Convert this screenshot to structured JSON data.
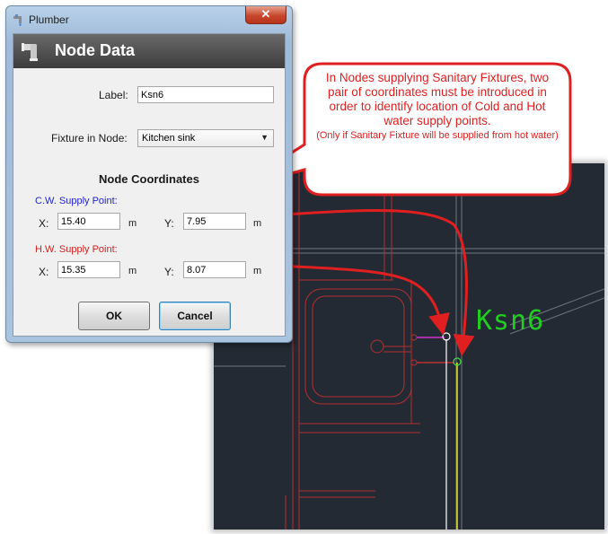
{
  "window": {
    "title": "Plumber",
    "close_glyph": "✕",
    "icon": "faucet-icon"
  },
  "header": {
    "title": "Node Data",
    "icon": "pipe-fitting-icon"
  },
  "form": {
    "label_caption": "Label:",
    "label_value": "Ksn6",
    "fixture_caption": "Fixture in Node:",
    "fixture_value": "Kitchen sink",
    "section_title": "Node Coordinates",
    "cw": {
      "caption": "C.W. Supply Point:",
      "x_caption": "X:",
      "x_value": "15.40",
      "x_unit": "m",
      "y_caption": "Y:",
      "y_value": "7.95",
      "y_unit": "m"
    },
    "hw": {
      "caption": "H.W. Supply Point:",
      "x_caption": "X:",
      "x_value": "15.35",
      "x_unit": "m",
      "y_caption": "Y:",
      "y_value": "8.07",
      "y_unit": "m"
    }
  },
  "buttons": {
    "ok": "OK",
    "cancel": "Cancel"
  },
  "callout": {
    "text": "In Nodes supplying Sanitary Fixtures, two pair of coordinates must be introduced in order to identify location of Cold and Hot water supply points.",
    "note": "(Only if Sanitary Fixture will be supplied from hot water)",
    "color": "#e02020"
  },
  "cad": {
    "node_label": "Ksn6",
    "background": "#232a33",
    "label_color": "#22cc22"
  }
}
